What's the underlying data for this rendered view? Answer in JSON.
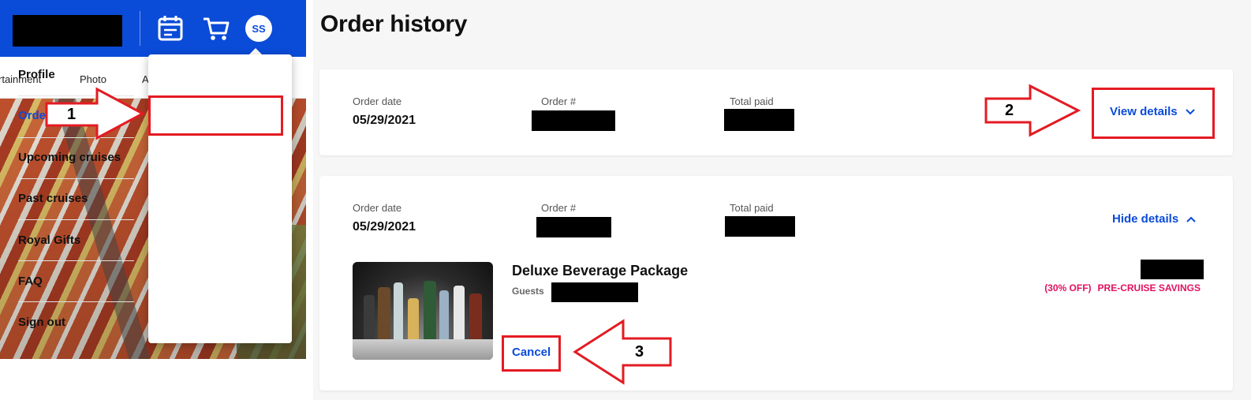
{
  "topbar": {
    "avatar_initials": "SS",
    "icons": [
      "calendar-icon",
      "cart-icon"
    ]
  },
  "nav": {
    "items": [
      "rtainment",
      "Photo",
      "A"
    ]
  },
  "menu": {
    "items": [
      {
        "label": "Profile"
      },
      {
        "label": "Order history",
        "active": true
      },
      {
        "label": "Upcoming cruises"
      },
      {
        "label": "Past cruises"
      },
      {
        "label": "Royal Gifts"
      },
      {
        "label": "FAQ"
      },
      {
        "label": "Sign out"
      }
    ]
  },
  "page": {
    "title": "Order history"
  },
  "orders": [
    {
      "date_label": "Order date",
      "date_value": "05/29/2021",
      "number_label": "Order #",
      "total_label": "Total paid",
      "toggle_label": "View details"
    },
    {
      "date_label": "Order date",
      "date_value": "05/29/2021",
      "number_label": "Order #",
      "total_label": "Total paid",
      "toggle_label": "Hide details",
      "item": {
        "name": "Deluxe Beverage Package",
        "guests_label": "Guests",
        "discount": "(30% OFF)",
        "savings_label": "PRE-CRUISE SAVINGS",
        "cancel_label": "Cancel"
      }
    }
  ],
  "annotations": {
    "step1": "1",
    "step2": "2",
    "step3": "3"
  },
  "colors": {
    "brand_blue": "#0a4bd8",
    "highlight_red": "#e31b23",
    "savings_pink": "#e0115f"
  }
}
